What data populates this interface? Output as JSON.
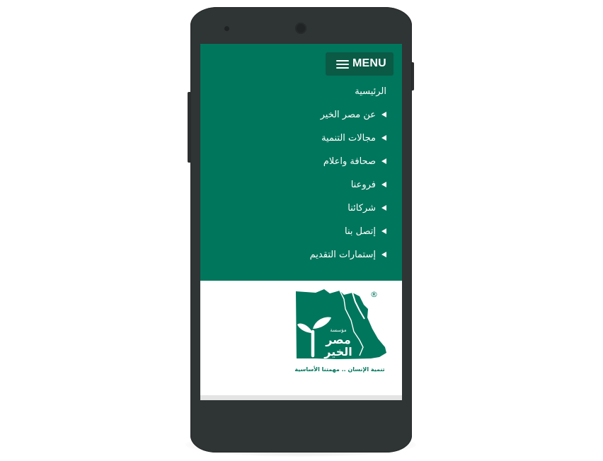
{
  "header": {
    "menu_label": "MENU"
  },
  "menu": {
    "items": [
      {
        "label": "الرئيسية",
        "has_arrow": false
      },
      {
        "label": "عن مصر الخير",
        "has_arrow": true
      },
      {
        "label": "مجالات التنمية",
        "has_arrow": true
      },
      {
        "label": "صحافة واعلام",
        "has_arrow": true
      },
      {
        "label": "فروعنا",
        "has_arrow": true
      },
      {
        "label": "شركائنا",
        "has_arrow": true
      },
      {
        "label": "إتصل بنا",
        "has_arrow": true
      },
      {
        "label": "إستمارات التقديم",
        "has_arrow": true
      }
    ]
  },
  "logo": {
    "name_small": "مؤسسة",
    "name_line1": "مصر",
    "name_line2": "الخير",
    "tagline": "تنمية الإنسان .. مهمتنا الأساسية",
    "registered_mark": "®",
    "icon": "egypt-map-sprout-icon"
  },
  "colors": {
    "nav_green": "#00765c",
    "menu_button": "#0a5a46",
    "device_body": "#2f3434"
  }
}
